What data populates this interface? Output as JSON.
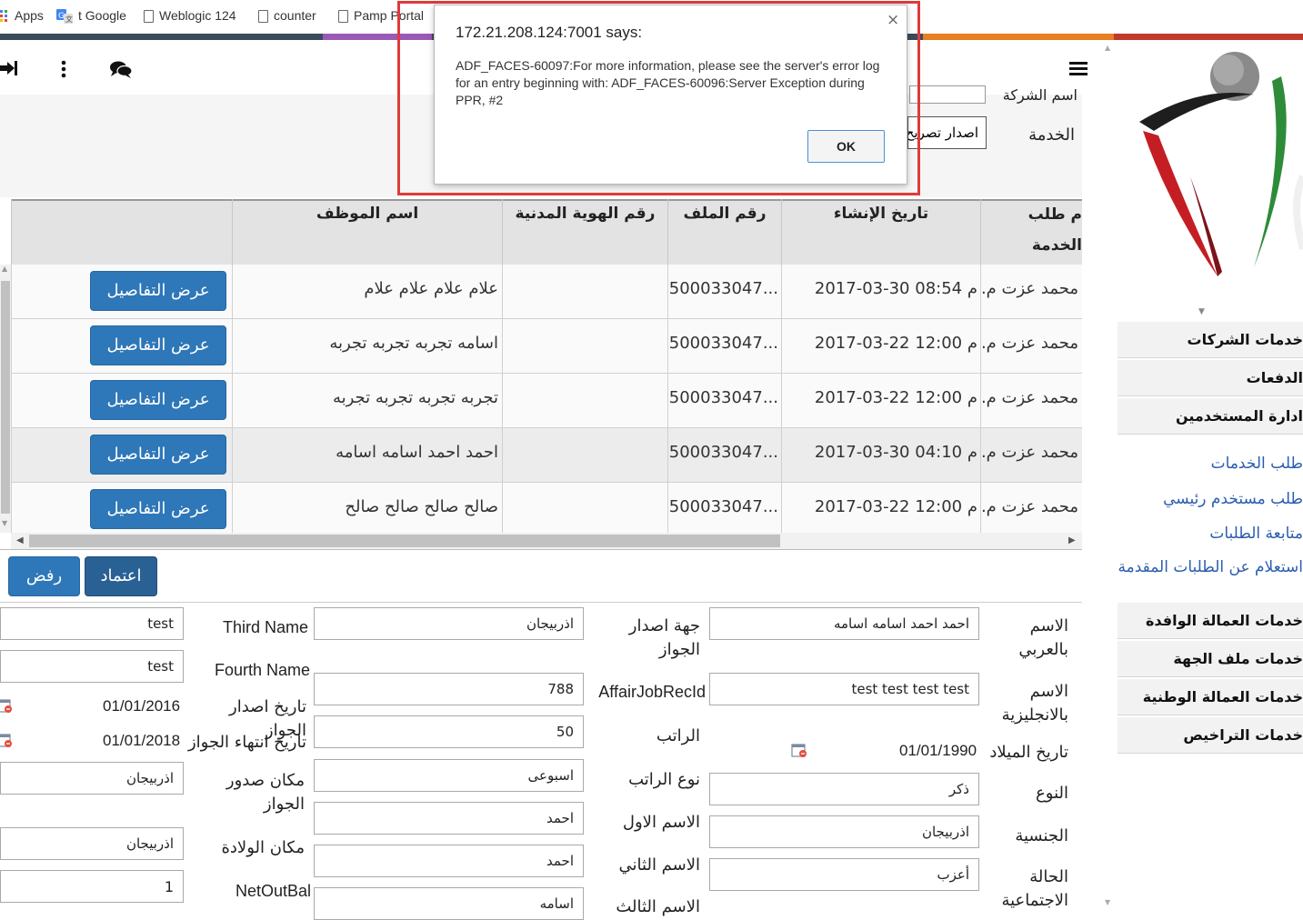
{
  "bookmarks": {
    "apps": "Apps",
    "google": "t Google",
    "weblogic": "Weblogic 124",
    "counter": "counter",
    "pamp": "Pamp Portal"
  },
  "colors": {
    "accent_blue": "#2e77b8",
    "approve_blue": "#2a6195",
    "dialog_highlight": "#e03a3a",
    "link_blue": "#2a5db0"
  },
  "toolbar": {
    "icons": [
      "logout-icon",
      "more-vertical-icon",
      "chat-icon",
      "hamburger-menu-icon"
    ]
  },
  "filter": {
    "company_label": "اسم الشركة",
    "service_label": "الخدمة",
    "service_value": "اصدار تصريح"
  },
  "table": {
    "headers": {
      "requested_by": "م طلب الخدمة بواسطة",
      "created": "تاريخ الإنشاء",
      "file_no": "رقم الملف",
      "civil_id": "رقم الهوية المدنية",
      "employee": "اسم الموظف"
    },
    "rows": [
      {
        "requested_by": "محمد عزت م...",
        "created": "2017-03-30 م 08:54",
        "file_no": "500033047...",
        "civil_id": "",
        "employee": "علام علام علام علام",
        "action": "عرض التفاصيل"
      },
      {
        "requested_by": "محمد عزت م...",
        "created": "2017-03-22 م 12:00",
        "file_no": "500033047...",
        "civil_id": "",
        "employee": "اسامه تجربه تجربه تجربه",
        "action": "عرض التفاصيل"
      },
      {
        "requested_by": "محمد عزت م...",
        "created": "2017-03-22 م 12:00",
        "file_no": "500033047...",
        "civil_id": "",
        "employee": "تجربه تجربه تجربه تجربه",
        "action": "عرض التفاصيل"
      },
      {
        "requested_by": "محمد عزت م...",
        "created": "2017-03-30 م 04:10",
        "file_no": "500033047...",
        "civil_id": "",
        "employee": "احمد احمد اسامه اسامه",
        "action": "عرض التفاصيل"
      },
      {
        "requested_by": "محمد عزت م...",
        "created": "2017-03-22 م 12:00",
        "file_no": "500033047...",
        "civil_id": "",
        "employee": "صالح صالح صالح صالح",
        "action": "عرض التفاصيل"
      }
    ]
  },
  "actions": {
    "approve": "اعتماد",
    "reject": "رفض"
  },
  "form": {
    "name_ar_label": "الاسم بالعربي",
    "name_ar_value": "احمد احمد اسامه اسامه",
    "name_en_label": "الاسم بالانجليزية",
    "name_en_value": "test test test test",
    "dob_label": "تاريخ الميلاد",
    "dob_value": "01/01/1990",
    "gender_label": "النوع",
    "gender_value": "ذكر",
    "nationality_label": "الجنسية",
    "nationality_value": "اذربيجان",
    "marital_label": "الحالة الاجتماعية",
    "marital_value": "أعزب",
    "passport_issuer_label": "جهة اصدار الجواز",
    "passport_issuer_value": "اذربيجان",
    "affair_label": "AffairJobRecId",
    "affair_value": "788",
    "salary_label": "الراتب",
    "salary_value": "50",
    "salary_type_label": "نوع الراتب",
    "salary_type_value": "اسبوعى",
    "first_name_label": "الاسم الاول",
    "first_name_value": "احمد",
    "second_name_label": "الاسم الثاني",
    "second_name_value": "احمد",
    "third_name_ar_label": "الاسم الثالث",
    "third_name_ar_value": "اسامه",
    "third_name_label": "Third Name",
    "third_name_value": "test",
    "fourth_name_label": "Fourth Name",
    "fourth_name_value": "test",
    "passport_issue_label": "تاريخ اصدار الجواز",
    "passport_issue_value": "01/01/2016",
    "passport_expiry_label": "تاريخ انتهاء الجواز",
    "passport_expiry_value": "01/01/2018",
    "passport_place_label": "مكان صدور الجواز",
    "passport_place_value": "اذربيجان",
    "birth_place_label": "مكان الولادة",
    "birth_place_value": "اذربيجان",
    "netoutbal_label": "NetOutBal",
    "netoutbal_value": "1"
  },
  "sidebar": {
    "items": [
      {
        "label": "خدمات الشركات"
      },
      {
        "label": "الدفعات"
      },
      {
        "label": "ادارة المستخدمين"
      },
      {
        "label": "خدمات العمالة الوافدة"
      },
      {
        "label": "خدمات ملف الجهة"
      },
      {
        "label": "خدمات العمالة الوطنية"
      },
      {
        "label": "خدمات التراخيص"
      }
    ],
    "links": [
      {
        "label": "طلب الخدمات"
      },
      {
        "label": "طلب مستخدم رئيسي"
      },
      {
        "label": "متابعة الطلبات"
      },
      {
        "label": "استعلام عن الطلبات المقدمة"
      }
    ]
  },
  "dialog": {
    "title": "172.21.208.124:7001 says:",
    "message": "ADF_FACES-60097:For more information, please see the server's error log for an entry beginning with: ADF_FACES-60096:Server Exception during PPR, #2",
    "ok": "OK",
    "close": "×"
  }
}
